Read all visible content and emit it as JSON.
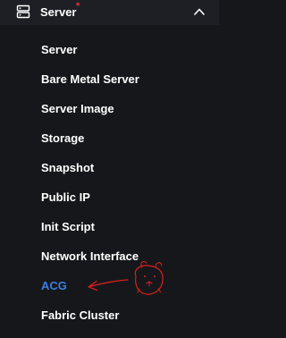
{
  "menu": {
    "header": {
      "label": "Server",
      "required_mark": "*",
      "icon": "server-stack-icon",
      "expand_icon": "chevron-up-icon",
      "expanded": true
    },
    "items": [
      {
        "label": "Server"
      },
      {
        "label": "Bare Metal Server"
      },
      {
        "label": "Server Image"
      },
      {
        "label": "Storage"
      },
      {
        "label": "Snapshot"
      },
      {
        "label": "Public IP"
      },
      {
        "label": "Init Script"
      },
      {
        "label": "Network Interface"
      },
      {
        "label": "ACG",
        "active": true
      },
      {
        "label": "Fabric Cluster"
      }
    ],
    "active_item": "ACG"
  },
  "colors": {
    "background": "#16171b",
    "header_background": "#1e1f24",
    "text": "#ffffff",
    "active_text": "#3a7fe0",
    "required_mark": "#e8333c",
    "annotation": "#d71f1f"
  },
  "annotation": {
    "type": "hand-drawn-arrow-with-face",
    "points_to": "ACG"
  }
}
